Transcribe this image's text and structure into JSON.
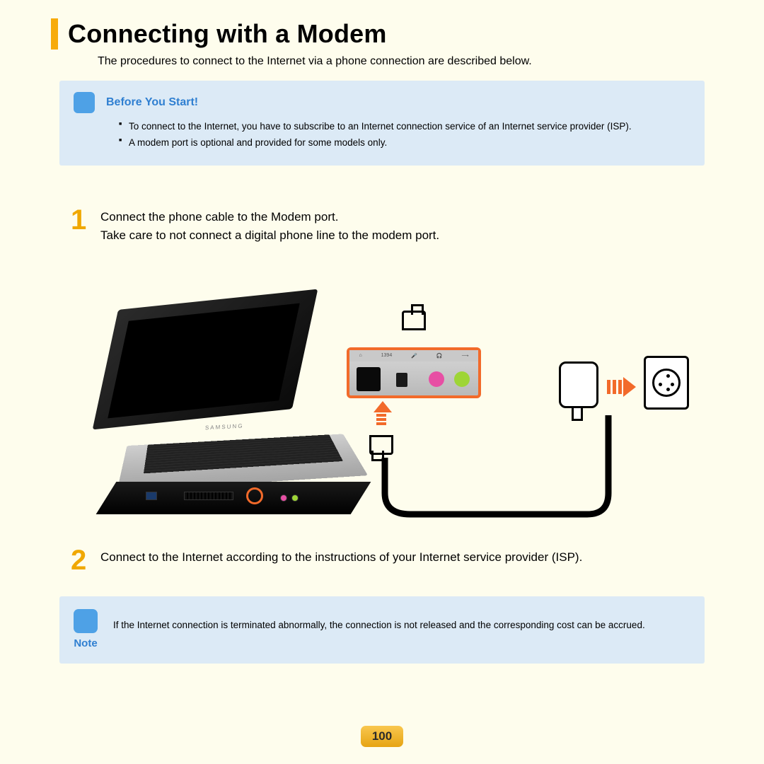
{
  "title": "Connecting with a Modem",
  "intro": "The procedures to connect to the Internet via a phone connection are described below.",
  "before": {
    "heading": "Before You Start!",
    "items": [
      "To connect to the Internet, you have to subscribe to an Internet connection service of an Internet service provider (ISP).",
      "A modem port is optional and provided for some models only."
    ]
  },
  "steps": {
    "s1": {
      "num": "1",
      "line1": "Connect the phone cable to the Modem port.",
      "line2": "Take care to not connect a digital phone line to the modem port."
    },
    "s2": {
      "num": "2",
      "text": "Connect to the Internet according to the instructions of your Internet service provider (ISP)."
    }
  },
  "note": {
    "label": "Note",
    "text": "If the Internet connection is terminated abnormally, the connection is not released and the corresponding cost can be accrued."
  },
  "laptop_brand": "SAMSUNG",
  "mag_labels": [
    "⌂",
    "1394",
    "🎤",
    "🎧",
    "⟶"
  ],
  "page_number": "100",
  "colors": {
    "accent_orange": "#f26a2a",
    "accent_yellow": "#f7ab0a",
    "callout_bg": "#dceaf6",
    "callout_blue": "#2f7fd1",
    "badge_blue": "#4ea1e6"
  }
}
